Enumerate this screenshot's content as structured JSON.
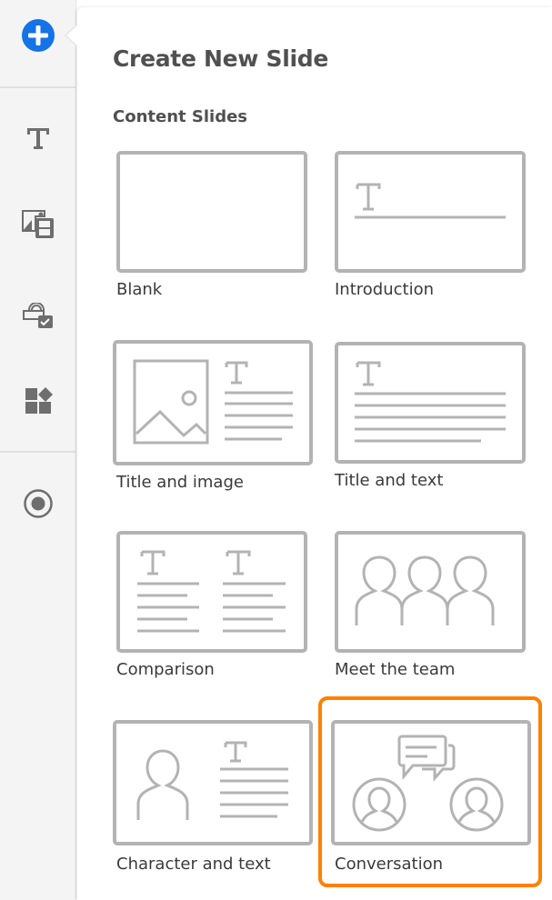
{
  "sidebar": {
    "items": [
      {
        "name": "add",
        "icon": "plus-circle-icon",
        "active": true
      },
      {
        "name": "text",
        "icon": "text-icon"
      },
      {
        "name": "media",
        "icon": "image-video-icon"
      },
      {
        "name": "interactions",
        "icon": "interaction-icon"
      },
      {
        "name": "widgets",
        "icon": "shapes-icon"
      },
      {
        "name": "record",
        "icon": "record-icon"
      }
    ]
  },
  "panel": {
    "title": "Create New Slide",
    "section": "Content Slides",
    "layouts": [
      {
        "label": "Blank"
      },
      {
        "label": "Introduction"
      },
      {
        "label": "Title and image"
      },
      {
        "label": "Title and text"
      },
      {
        "label": "Comparison"
      },
      {
        "label": "Meet the team"
      },
      {
        "label": "Character and text"
      },
      {
        "label": "Conversation",
        "selected": true
      }
    ]
  },
  "colors": {
    "accent": "#1473e6",
    "selection": "#ff8000",
    "thumb": "#b3b3b3"
  }
}
